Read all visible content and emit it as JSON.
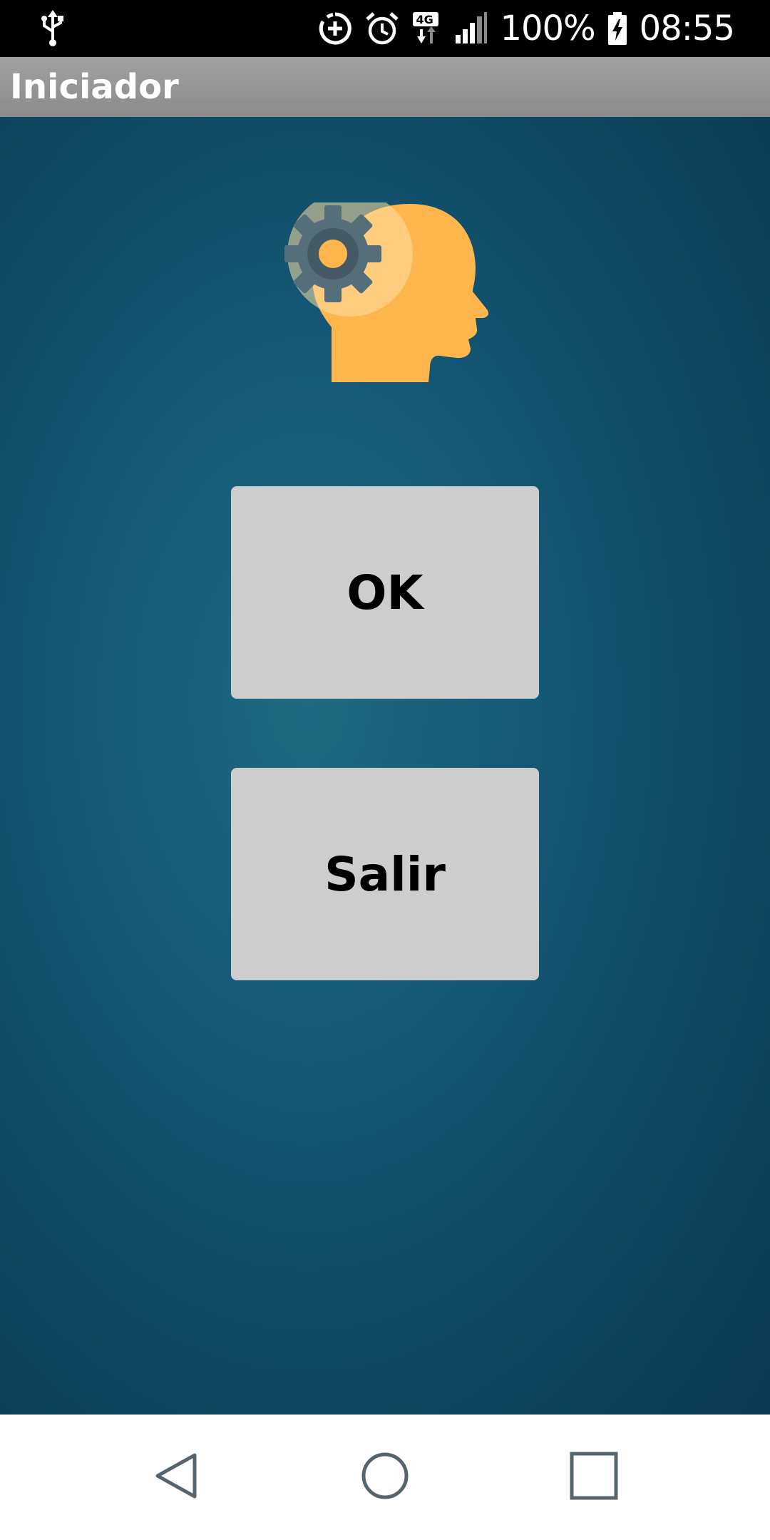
{
  "status_bar": {
    "left_icons": [
      "usb-icon"
    ],
    "right_icons": [
      "data-saver-icon",
      "alarm-icon",
      "network-4g-icon",
      "signal-icon",
      "battery-charging-icon"
    ],
    "network_label": "4G",
    "battery_percent": "100%",
    "time": "08:55"
  },
  "app_bar": {
    "title": "Iniciador"
  },
  "main": {
    "logo_icon": "head-gear-icon",
    "ok_button": "OK",
    "exit_button": "Salir"
  },
  "nav_bar": {
    "icons": [
      "back-icon",
      "home-icon",
      "recents-icon"
    ]
  },
  "colors": {
    "status_bar": "#000000",
    "app_bar": "#9a9a9a",
    "background_center": "#1f6a82",
    "background_edge": "#0b3a55",
    "button": "#cdcdcd",
    "head": "#ffb74d",
    "gear": "#546e7a"
  }
}
